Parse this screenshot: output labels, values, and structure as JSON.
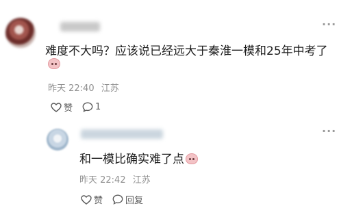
{
  "comments": [
    {
      "text": "难度不大吗？应该说已经远大于秦淮一模和25年中考了",
      "emoji_icon": "pig-face-emoji",
      "time": "昨天 22:40",
      "location": "江苏",
      "like_label": "赞",
      "reply_label": "1",
      "reply_icon": "comment-bubble-icon"
    },
    {
      "text": "和一模比确实难了点",
      "emoji_icon": "pig-face-emoji",
      "time": "昨天 22:42",
      "location": "江苏",
      "like_label": "赞",
      "reply_label": "回复",
      "reply_icon": "comment-bubble-icon"
    }
  ],
  "colors": {
    "meta_text": "#8f8f8f",
    "body_text": "#1c1c1c",
    "background": "#ffffff"
  }
}
